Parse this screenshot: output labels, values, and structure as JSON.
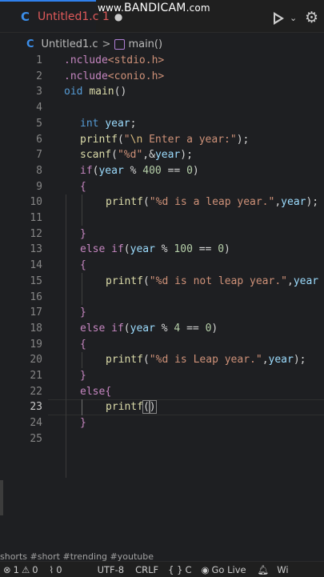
{
  "tab": {
    "language_icon": "C",
    "filename": "Untitled1.c",
    "modified_marker": "1",
    "modified_dot": "●"
  },
  "watermark": {
    "prefix": "www.",
    "text": "BANDICAM",
    "suffix": ".com"
  },
  "toolbar": {
    "run_icon": "play-icon",
    "run_dropdown": "⌄",
    "settings_icon": "gear-icon"
  },
  "breadcrumb": {
    "language_icon": "C",
    "file": "Untitled1.c",
    "separator": ">",
    "symbol_icon": "cube-icon",
    "symbol": "main()"
  },
  "editor": {
    "active_line": 23,
    "lines": [
      {
        "n": "1",
        "text": ".nclude<stdio.h>"
      },
      {
        "n": "2",
        "text": ".nclude<conio.h>"
      },
      {
        "n": "3",
        "text": "oid main()"
      },
      {
        "n": "4",
        "text": ""
      },
      {
        "n": "5",
        "text": "int year;"
      },
      {
        "n": "6",
        "text": "printf(\"\\n Enter a year:\");"
      },
      {
        "n": "7",
        "text": "scanf(\"%d\",&year);"
      },
      {
        "n": "8",
        "text": "if(year % 400 == 0)"
      },
      {
        "n": "9",
        "text": "{"
      },
      {
        "n": "10",
        "text": "printf(\"%d is a leap year.\",year);"
      },
      {
        "n": "11",
        "text": ""
      },
      {
        "n": "12",
        "text": "}"
      },
      {
        "n": "13",
        "text": "else if(year % 100 == 0)"
      },
      {
        "n": "14",
        "text": "{"
      },
      {
        "n": "15",
        "text": "printf(\"%d is not leap year.\",year"
      },
      {
        "n": "16",
        "text": ""
      },
      {
        "n": "17",
        "text": "}"
      },
      {
        "n": "18",
        "text": "else if(year % 4 == 0)"
      },
      {
        "n": "19",
        "text": "{"
      },
      {
        "n": "20",
        "text": "printf(\"%d is Leap year.\",year);"
      },
      {
        "n": "21",
        "text": "}"
      },
      {
        "n": "22",
        "text": "else{"
      },
      {
        "n": "23",
        "text": "printf()"
      },
      {
        "n": "24",
        "text": "}"
      },
      {
        "n": "25",
        "text": ""
      }
    ]
  },
  "overlay_text": "shorts #short #trending #youtube",
  "statusbar": {
    "errors_icon": "error-icon",
    "errors": "1",
    "warnings_icon": "warning-icon",
    "warnings": "0",
    "ports_icon": "broadcast-icon",
    "ports": "0",
    "encoding": "UTF-8",
    "eol": "CRLF",
    "language_braces": "{ }",
    "language": "C",
    "golive_icon": "broadcast-icon",
    "golive": "Go Live",
    "notifications_icon": "bell-icon",
    "platform": "Wi"
  },
  "colors": {
    "keyword": "#569cd6",
    "function": "#dcdcaa",
    "string": "#ce9178",
    "number": "#b5cea8",
    "variable": "#9cdcfe",
    "control": "#c586c0",
    "tab_accent": "#2f80ed",
    "tab_modified": "#e05a5a"
  }
}
